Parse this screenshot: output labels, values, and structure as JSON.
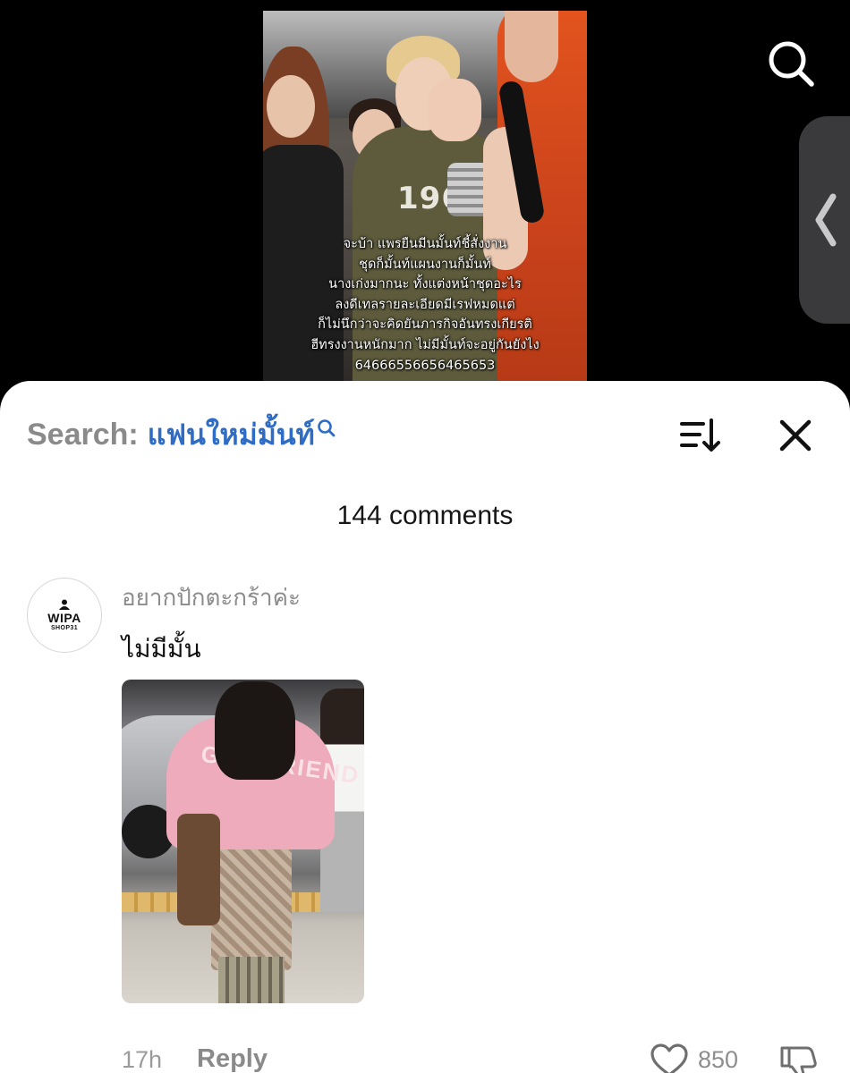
{
  "video": {
    "jersey_text": "1966",
    "caption_lines": [
      "จะบ้า แพรยืนมีนมั้นท์ชี้สั่งงาน",
      "ชุดก็มั้นท์แผนงานก็มั้นท์",
      "นางเก่งมากนะ ทั้งแต่งหน้าชุดอะไร",
      "ลงดีเทลรายละเอียดมีเรฟหมดแต่",
      "ก็ไม่นึกว่าจะคิดยันภารกิจอันทรงเกียรติ",
      "ฮีทรงงานหนักมาก  ไม่มีมั้นท์จะอยู่กันยังไง",
      "6466655665646565​3"
    ]
  },
  "sheet": {
    "search_label": "Search:",
    "search_term": "แฟนใหม่มั้นท์",
    "comment_count": "144 comments"
  },
  "comment": {
    "avatar_brand": "WIPA",
    "avatar_sub": "SHOP31",
    "username": "อยากปักตะกร้าค่ะ",
    "text": "ไม่มีมั้น",
    "photo_text": "GIRLFRIEND",
    "time": "17h",
    "reply_label": "Reply",
    "like_count": "850"
  },
  "icons": {
    "search": "search-icon",
    "panel": "chevron-left-icon",
    "sort": "sort-icon",
    "close": "close-icon",
    "like": "heart-icon",
    "dislike": "thumbs-down-icon"
  },
  "colors": {
    "search_term": "#2f6cc6",
    "background": "#000000",
    "sheet": "#ffffff"
  }
}
